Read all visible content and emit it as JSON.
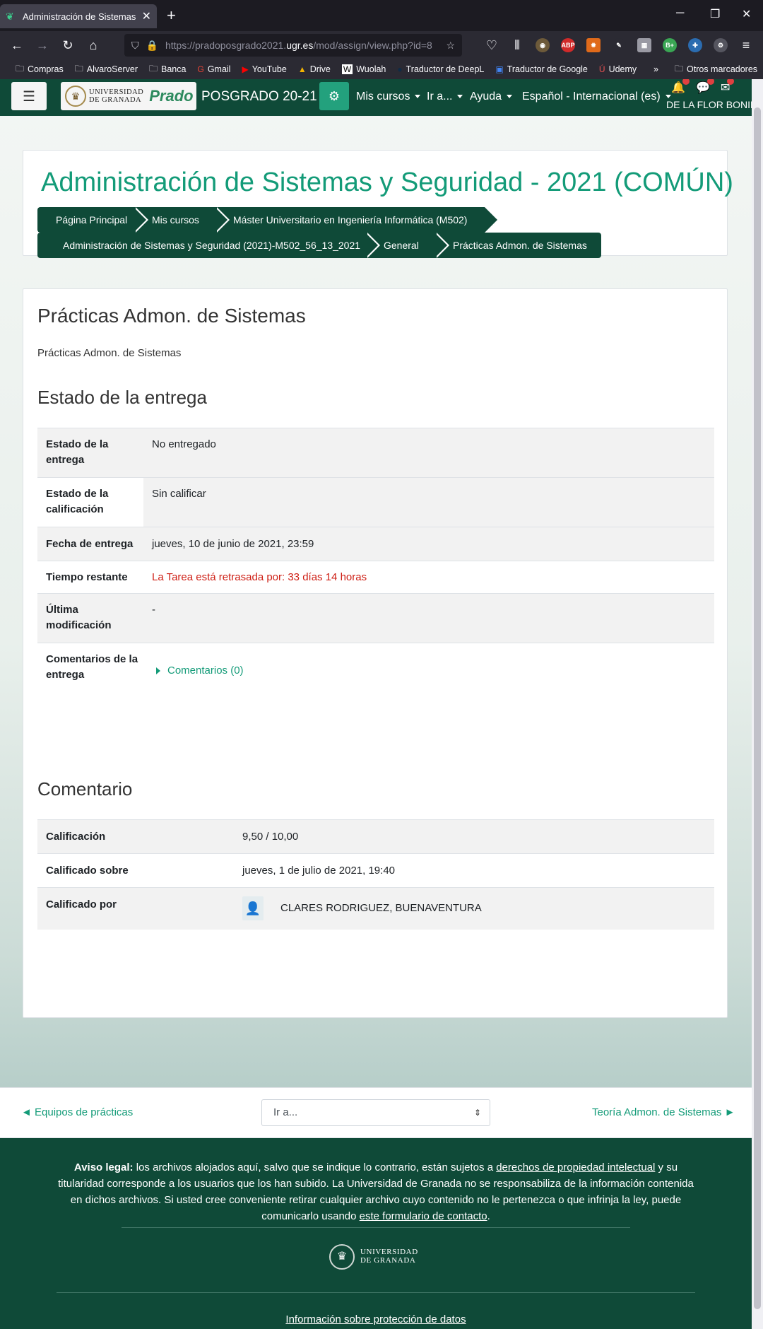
{
  "browser": {
    "tab_title": "Administración de Sistemas y Segu...",
    "url_prefix": "https://pradoposgrado2021.",
    "url_domain": "ugr.es",
    "url_suffix": "/mod/assign/view.php?id=8",
    "bookmarks": [
      "Compras",
      "AlvaroServer",
      "Banca",
      "Gmail",
      "YouTube",
      "Drive",
      "Wuolah",
      "Traductor de DeepL",
      "Traductor de Google",
      "Udemy"
    ],
    "bookmarks_other": "Otros marcadores"
  },
  "nav": {
    "logo_line1": "UNIVERSIDAD",
    "logo_line2": "DE GRANADA",
    "logo_prado": "Prado",
    "site_name": "POSGRADO 20-21",
    "mis_cursos": "Mis cursos",
    "ir_a": "Ir a...",
    "ayuda": "Ayuda",
    "idioma": "Español - Internacional (es)",
    "user": "DE LA FLOR BONIL"
  },
  "header": {
    "course_title": "Administración de Sistemas y Seguridad - 2021 (COMÚN)",
    "breadcrumb": [
      "Página Principal",
      "Mis cursos",
      "Máster Universitario en Ingeniería Informática (M502)",
      "Administración de Sistemas y Seguridad (2021)-M502_56_13_2021",
      "General",
      "Prácticas Admon. de Sistemas"
    ]
  },
  "assignment": {
    "title": "Prácticas Admon. de Sistemas",
    "description": "Prácticas Admon. de Sistemas",
    "status_heading": "Estado de la entrega",
    "status_rows": [
      {
        "label_1": "Estado de la",
        "label_2": "entrega",
        "value": "No entregado"
      },
      {
        "label_1": "Estado de la",
        "label_2": "calificación",
        "value": "Sin calificar"
      },
      {
        "label": "Fecha de entrega",
        "value": "jueves, 10 de junio de 2021, 23:59"
      },
      {
        "label": "Tiempo restante",
        "value": "La Tarea está retrasada por: 33 días 14 horas"
      },
      {
        "label_1": "Última",
        "label_2": "modificación",
        "value": "-"
      },
      {
        "label_1": "Comentarios de la",
        "label_2": "entrega",
        "value": "Comentarios (0)"
      }
    ],
    "feedback_heading": "Comentario",
    "feedback_rows": [
      {
        "label": "Calificación",
        "value": "9,50 / 10,00"
      },
      {
        "label": "Calificado sobre",
        "value": "jueves, 1 de julio de 2021, 19:40"
      },
      {
        "label": "Calificado por",
        "value": "CLARES RODRIGUEZ, BUENAVENTURA"
      }
    ]
  },
  "pagenav": {
    "prev": "◄ Equipos de prácticas",
    "jump": "Ir a...",
    "next": "Teoría Admon. de Sistemas ►"
  },
  "footer": {
    "legal_bold": "Aviso legal:",
    "legal_1": " los archivos alojados aquí, salvo que se indique lo contrario, están sujetos a ",
    "legal_link1": "derechos de propiedad intelectual",
    "legal_2": " y su titularidad corresponde a los usuarios que los han subido. La Universidad de Granada no se responsabiliza de la información contenida en dichos archivos. Si usted cree conveniente retirar cualquier archivo cuyo contenido no le pertenezca o que infrinja la ley, puede comunicarlo usando ",
    "legal_link2": "este formulario de contacto",
    "legal_3": ".",
    "logo_line1": "UNIVERSIDAD",
    "logo_line2": "DE GRANADA",
    "privacy": "Información sobre protección de datos"
  },
  "colors": {
    "brand_dark": "#0f4a38",
    "brand_accent": "#139b78",
    "overdue": "#ce1e14"
  }
}
